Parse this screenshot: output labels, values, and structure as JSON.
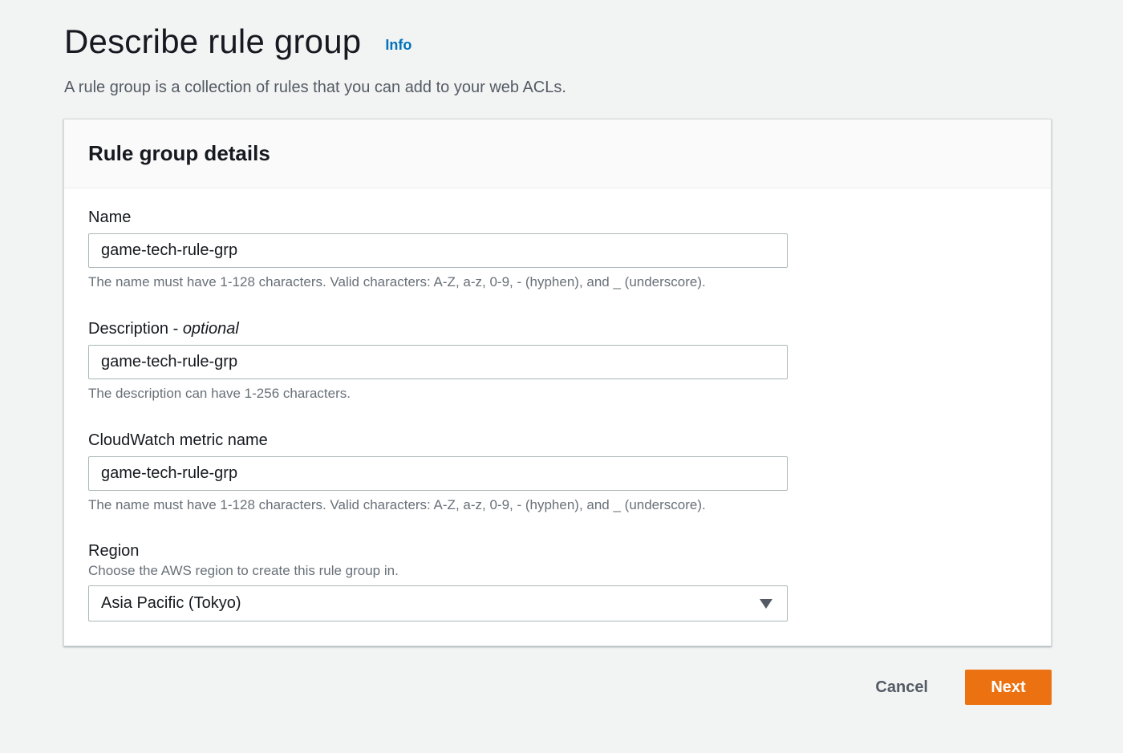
{
  "header": {
    "title": "Describe rule group",
    "info_label": "Info",
    "description": "A rule group is a collection of rules that you can add to your web ACLs."
  },
  "panel": {
    "title": "Rule group details",
    "name": {
      "label": "Name",
      "value": "game-tech-rule-grp",
      "constraint": "The name must have 1-128 characters. Valid characters: A-Z, a-z, 0-9, - (hyphen), and _ (underscore)."
    },
    "description": {
      "label": "Description - ",
      "label_optional": "optional",
      "value": "game-tech-rule-grp",
      "constraint": "The description can have 1-256 characters."
    },
    "metric": {
      "label": "CloudWatch metric name",
      "value": "game-tech-rule-grp",
      "constraint": "The name must have 1-128 characters. Valid characters: A-Z, a-z, 0-9, - (hyphen), and _ (underscore)."
    },
    "region": {
      "label": "Region",
      "description": "Choose the AWS region to create this rule group in.",
      "selected": "Asia Pacific (Tokyo)",
      "icon": "caret-down-icon"
    }
  },
  "actions": {
    "cancel_label": "Cancel",
    "next_label": "Next"
  },
  "colors": {
    "accent": "#ec7211",
    "link": "#0073bb",
    "background": "#f2f3f3"
  }
}
